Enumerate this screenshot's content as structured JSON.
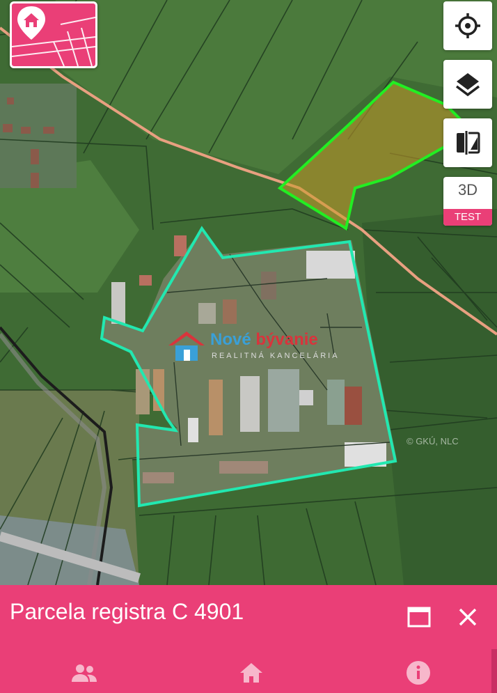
{
  "map": {
    "watermark": {
      "brand_part1": "Nové",
      "brand_part2": "bývanie",
      "tagline": "REALITNÁ KANCELÁRIA"
    },
    "copyright": "© GKÚ, NLC",
    "colors": {
      "selected_parcel_outline": "#22e8b0",
      "highlight_parcel_outline": "#22ee22",
      "highlight_parcel_fill": "#c89a2a",
      "road_line": "#e8a080",
      "brand_pink": "#ea3f77"
    }
  },
  "controls": {
    "logo": {
      "icon": "map-pin-home-icon"
    },
    "locate": {
      "icon": "crosshair-icon"
    },
    "layers": {
      "icon": "layers-icon"
    },
    "compare": {
      "icon": "split-compare-icon"
    },
    "view3d": {
      "label": "3D",
      "badge": "TEST"
    }
  },
  "panel": {
    "title": "Parcela registra C 4901",
    "maximize_icon": "maximize-icon",
    "close_icon": "close-icon",
    "tabs": [
      {
        "icon": "people-icon"
      },
      {
        "icon": "home-icon"
      },
      {
        "icon": "info-icon"
      }
    ]
  }
}
